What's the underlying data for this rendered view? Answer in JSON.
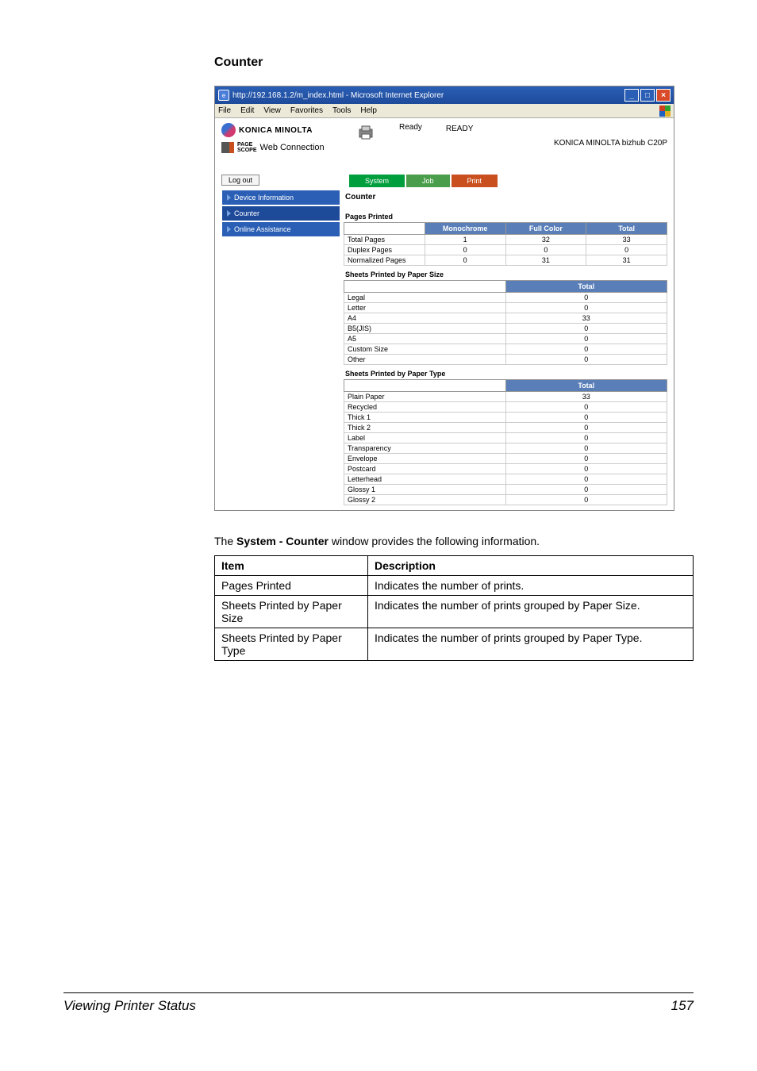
{
  "section_title": "Counter",
  "browser": {
    "title": "http://192.168.1.2/m_index.html - Microsoft Internet Explorer",
    "menu": {
      "file": "File",
      "edit": "Edit",
      "view": "View",
      "favorites": "Favorites",
      "tools": "Tools",
      "help": "Help"
    }
  },
  "header": {
    "brand": "KONICA MINOLTA",
    "pagescope": "Web Connection",
    "status_label": "Ready",
    "ready": "READY",
    "device": "KONICA MINOLTA bizhub C20P"
  },
  "logout": {
    "label": "Log out"
  },
  "tabs": {
    "system": "System",
    "job": "Job",
    "print": "Print"
  },
  "sidebar": {
    "items": [
      {
        "label": "Device Information"
      },
      {
        "label": "Counter"
      },
      {
        "label": "Online Assistance"
      }
    ]
  },
  "panel": {
    "title": "Counter",
    "pages_printed": {
      "label": "Pages Printed",
      "headers": {
        "blank": "",
        "mono": "Monochrome",
        "full": "Full Color",
        "total": "Total"
      },
      "rows": [
        {
          "label": "Total Pages",
          "mono": "1",
          "full": "32",
          "total": "33"
        },
        {
          "label": "Duplex Pages",
          "mono": "0",
          "full": "0",
          "total": "0"
        },
        {
          "label": "Normalized Pages",
          "mono": "0",
          "full": "31",
          "total": "31"
        }
      ]
    },
    "sheets_size": {
      "label": "Sheets Printed by Paper Size",
      "header_total": "Total",
      "rows": [
        {
          "label": "Legal",
          "total": "0"
        },
        {
          "label": "Letter",
          "total": "0"
        },
        {
          "label": "A4",
          "total": "33"
        },
        {
          "label": "B5(JIS)",
          "total": "0"
        },
        {
          "label": "A5",
          "total": "0"
        },
        {
          "label": "Custom Size",
          "total": "0"
        },
        {
          "label": "Other",
          "total": "0"
        }
      ]
    },
    "sheets_type": {
      "label": "Sheets Printed by Paper Type",
      "header_total": "Total",
      "rows": [
        {
          "label": "Plain Paper",
          "total": "33"
        },
        {
          "label": "Recycled",
          "total": "0"
        },
        {
          "label": "Thick 1",
          "total": "0"
        },
        {
          "label": "Thick 2",
          "total": "0"
        },
        {
          "label": "Label",
          "total": "0"
        },
        {
          "label": "Transparency",
          "total": "0"
        },
        {
          "label": "Envelope",
          "total": "0"
        },
        {
          "label": "Postcard",
          "total": "0"
        },
        {
          "label": "Letterhead",
          "total": "0"
        },
        {
          "label": "Glossy 1",
          "total": "0"
        },
        {
          "label": "Glossy 2",
          "total": "0"
        }
      ]
    }
  },
  "description_line": {
    "prefix": "The ",
    "bold": "System - Counter",
    "suffix": " window provides the following information."
  },
  "desc_table": {
    "headers": {
      "item": "Item",
      "desc": "Description"
    },
    "rows": [
      {
        "item": "Pages Printed",
        "desc": "Indicates the number of prints."
      },
      {
        "item": "Sheets Printed by Paper Size",
        "desc": "Indicates the number of prints grouped by Paper Size."
      },
      {
        "item": "Sheets Printed by Paper Type",
        "desc": "Indicates the number of prints grouped by Paper Type."
      }
    ]
  },
  "footer": {
    "left": "Viewing Printer Status",
    "right": "157"
  }
}
